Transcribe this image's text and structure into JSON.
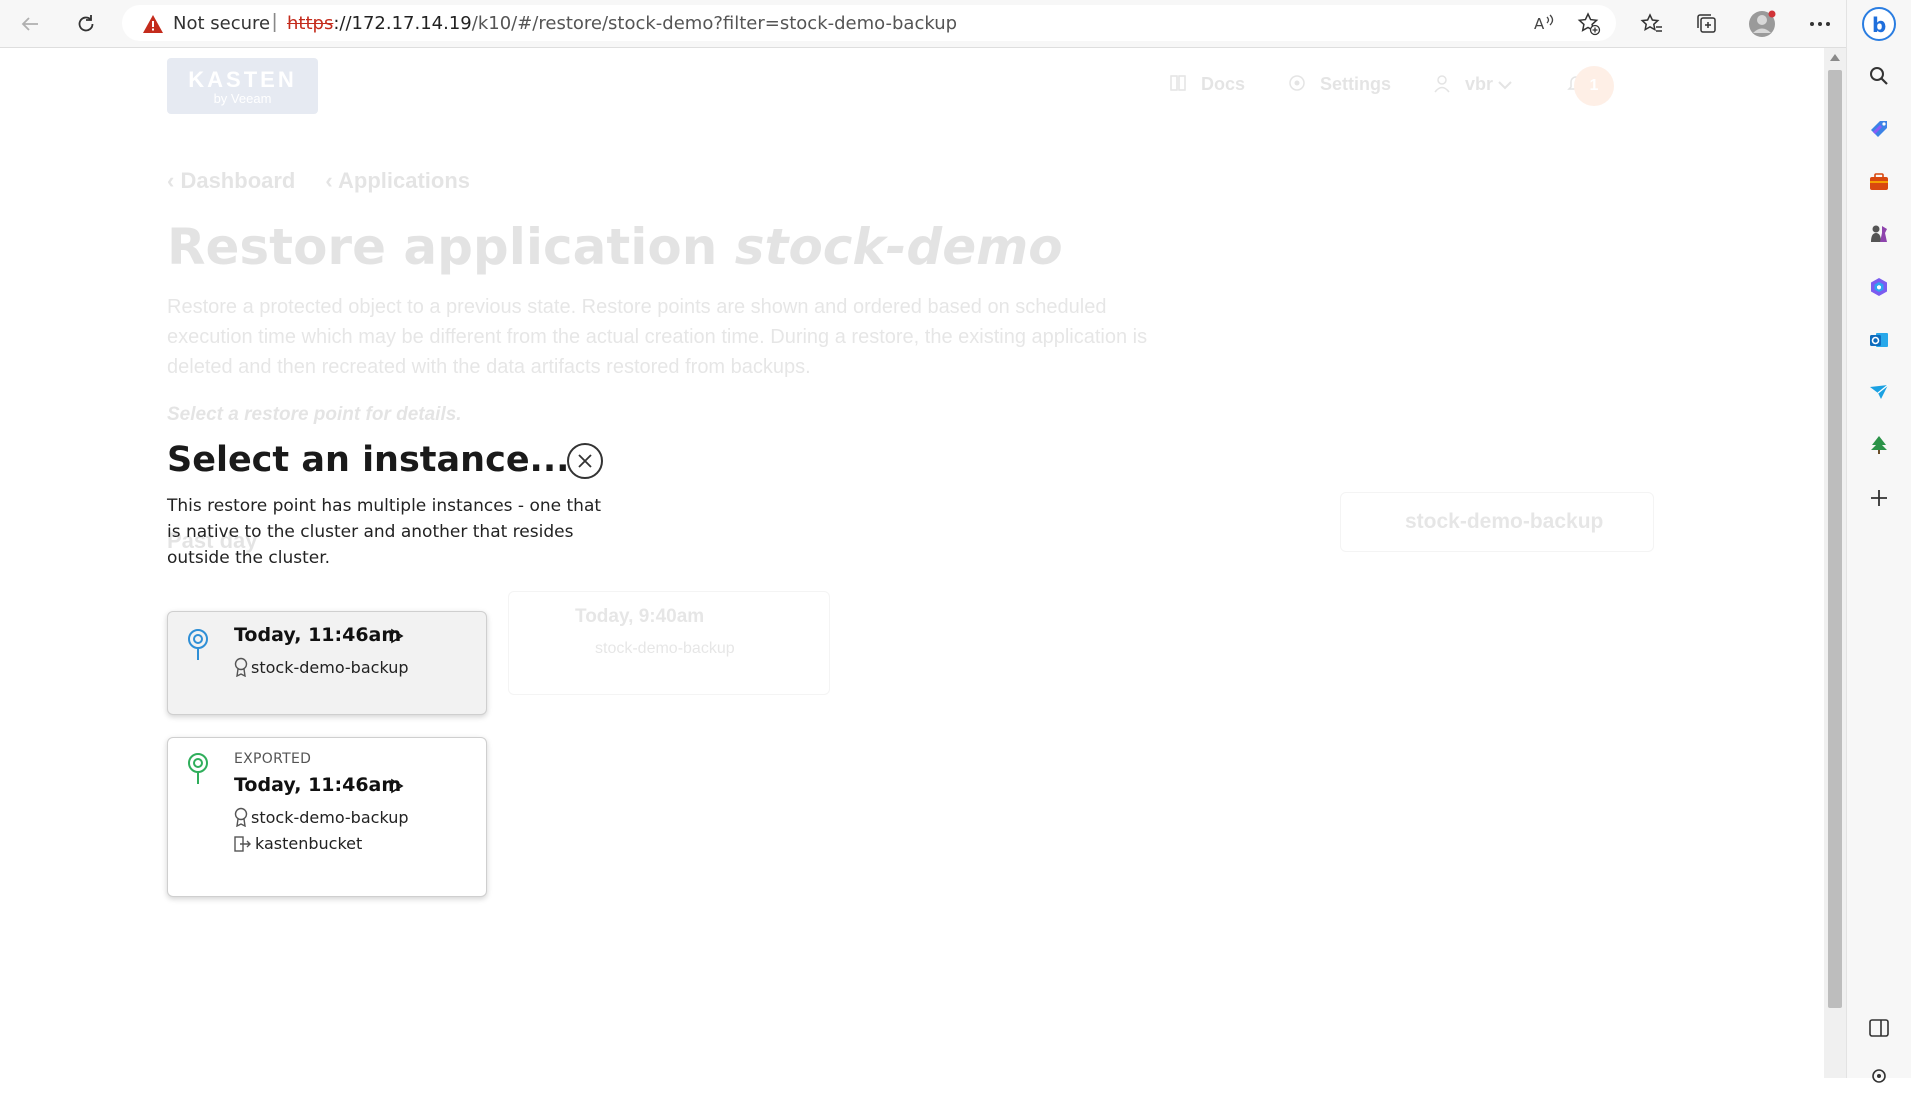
{
  "browser": {
    "security_label": "Not secure",
    "url_protocol": "https",
    "url_host": "://172.17.14.19",
    "url_path": "/k10/#/restore/stock-demo?filter=stock-demo-backup"
  },
  "app": {
    "logo_top": "KASTEN",
    "logo_bottom": "by Veeam",
    "nav": {
      "docs": "Docs",
      "settings": "Settings",
      "user": "vbr",
      "notifications": "1"
    },
    "breadcrumb": [
      "Dashboard",
      "Applications"
    ],
    "title_prefix": "Restore application ",
    "title_app": "stock-demo",
    "description": "Restore a protected object to a previous state. Restore points are shown and ordered based on scheduled execution time which may be different from the actual creation time. During a restore, the existing application is deleted and then recreated with the data artifacts restored from backups.",
    "select_hint": "Select a restore point for details.",
    "section_label": "Past day",
    "background_card": {
      "time": "Today, 9:40am",
      "tag": "stock-demo-backup"
    },
    "filter_chip": "stock-demo-backup"
  },
  "dialog": {
    "title": "Select an instance...",
    "text": "This restore point has multiple instances - one that is native to the cluster and another that resides outside the cluster.",
    "instances": [
      {
        "time": "Today, 11:46am",
        "policy": "stock-demo-backup"
      },
      {
        "label": "EXPORTED",
        "time": "Today, 11:46am",
        "policy": "stock-demo-backup",
        "location": "kastenbucket"
      }
    ]
  },
  "colors": {
    "accent_blue": "#2f8fd6",
    "export_green": "#2fae5b",
    "brand": "#1c3f8a",
    "badge": "#f06a23"
  }
}
